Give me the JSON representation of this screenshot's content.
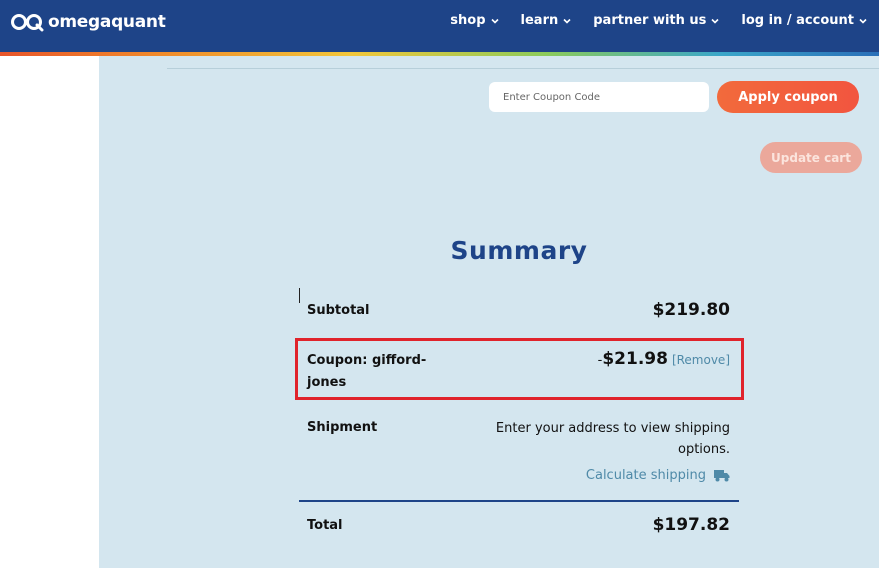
{
  "header": {
    "logo_text": "omegaquant",
    "nav": [
      {
        "label": "shop"
      },
      {
        "label": "learn"
      },
      {
        "label": "partner with us"
      },
      {
        "label": "log in / account"
      }
    ]
  },
  "cart": {
    "coupon_placeholder": "Enter Coupon Code",
    "apply_label": "Apply coupon",
    "update_label": "Update cart"
  },
  "summary": {
    "title": "Summary",
    "subtotal_label": "Subtotal",
    "subtotal_value": "$219.80",
    "coupon_label": "Coupon: gifford-jones",
    "coupon_sign": "-",
    "coupon_value": "$21.98",
    "remove_label": "[Remove]",
    "shipment_label": "Shipment",
    "shipment_text": "Enter your address to view shipping options.",
    "calc_shipping_label": "Calculate shipping",
    "total_label": "Total",
    "total_value": "$197.82"
  },
  "colors": {
    "header": "#1e4488",
    "panel": "#d4e6ef",
    "accent": "#f2553f",
    "highlight_box": "#e0232b",
    "link": "#4f8aa8"
  },
  "icons": [
    "omegaquant-logo-icon",
    "chevron-down-icon",
    "truck-icon"
  ]
}
